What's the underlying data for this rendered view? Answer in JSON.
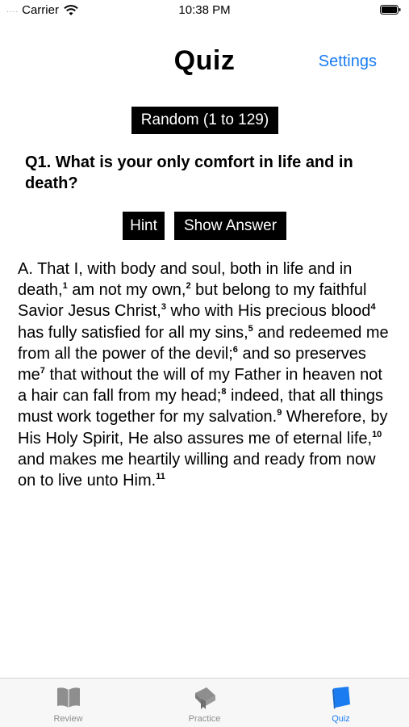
{
  "status_bar": {
    "signal": "....",
    "carrier": "Carrier",
    "time": "10:38 PM"
  },
  "nav": {
    "title": "Quiz",
    "settings_label": "Settings"
  },
  "quiz": {
    "random_label": "Random (1 to 129)",
    "question": "Q1. What is your only comfort in life and in death?",
    "hint_label": "Hint",
    "show_answer_label": "Show Answer",
    "answer_segments": [
      {
        "text": "A. That I, with body and soul, both in life and in death,",
        "ref": "1"
      },
      {
        "text": "  am not my own,",
        "ref": "2"
      },
      {
        "text": " but belong to my faithful Savior Jesus Christ,",
        "ref": "3"
      },
      {
        "text": " who with His precious blood",
        "ref": "4"
      },
      {
        "text": " has fully satisfied for all my sins,",
        "ref": "5"
      },
      {
        "text": " and redeemed me from all the power of the devil;",
        "ref": "6"
      },
      {
        "text": " and so preserves me",
        "ref": "7"
      },
      {
        "text": " that without the will of my Father in heaven not a hair can fall from my head;",
        "ref": "8"
      },
      {
        "text": " indeed, that all things must work together for my salvation.",
        "ref": "9"
      },
      {
        "text": " Wherefore, by His Holy Spirit, He also assures me of eternal life,",
        "ref": "10"
      },
      {
        "text": " and makes me heartily willing and ready from now on to live unto Him.",
        "ref": "11"
      }
    ]
  },
  "tabs": [
    {
      "label": "Review",
      "icon": "book-icon",
      "active": false
    },
    {
      "label": "Practice",
      "icon": "bookmark-book-icon",
      "active": false
    },
    {
      "label": "Quiz",
      "icon": "quiz-book-icon",
      "active": true
    }
  ],
  "colors": {
    "accent": "#1a7cf0",
    "inactive": "#8e8e8e",
    "button_bg": "#000000"
  }
}
